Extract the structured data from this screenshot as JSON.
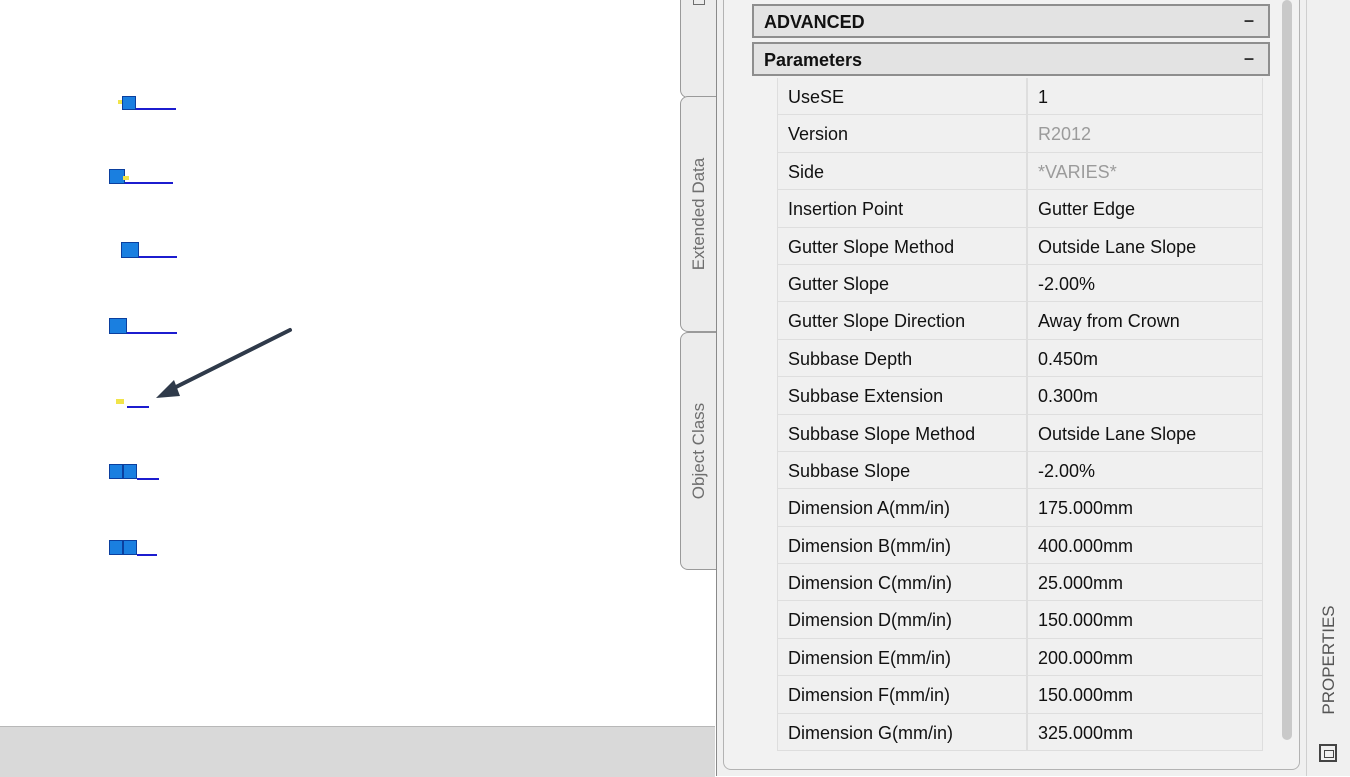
{
  "tabs": {
    "extended_data": "Extended Data",
    "object_class": "Object Class"
  },
  "sections": {
    "advanced": "ADVANCED",
    "parameters": "Parameters",
    "collapse_symbol": "–"
  },
  "properties": [
    {
      "name": "UseSE",
      "value": "1",
      "readonly": false
    },
    {
      "name": "Version",
      "value": "R2012",
      "readonly": true
    },
    {
      "name": "Side",
      "value": "*VARIES*",
      "readonly": true
    },
    {
      "name": "Insertion Point",
      "value": "Gutter Edge",
      "readonly": false
    },
    {
      "name": "Gutter Slope Method",
      "value": "Outside Lane Slope",
      "readonly": false
    },
    {
      "name": "Gutter Slope",
      "value": "-2.00%",
      "readonly": false
    },
    {
      "name": "Gutter Slope Direction",
      "value": "Away from Crown",
      "readonly": false
    },
    {
      "name": "Subbase Depth",
      "value": "0.450m",
      "readonly": false
    },
    {
      "name": "Subbase Extension",
      "value": "0.300m",
      "readonly": false
    },
    {
      "name": "Subbase Slope Method",
      "value": "Outside Lane Slope",
      "readonly": false
    },
    {
      "name": "Subbase Slope",
      "value": "-2.00%",
      "readonly": false
    },
    {
      "name": "Dimension A(mm/in)",
      "value": "175.000mm",
      "readonly": false
    },
    {
      "name": "Dimension B(mm/in)",
      "value": "400.000mm",
      "readonly": false
    },
    {
      "name": "Dimension C(mm/in)",
      "value": "25.000mm",
      "readonly": false
    },
    {
      "name": "Dimension D(mm/in)",
      "value": "150.000mm",
      "readonly": false
    },
    {
      "name": "Dimension E(mm/in)",
      "value": "200.000mm",
      "readonly": false
    },
    {
      "name": "Dimension F(mm/in)",
      "value": "150.000mm",
      "readonly": false
    },
    {
      "name": "Dimension G(mm/in)",
      "value": "325.000mm",
      "readonly": false
    }
  ],
  "dock": {
    "label": "PROPERTIES",
    "icon": "properties-palette-icon"
  },
  "colors": {
    "subassembly_fill": "#1a7fe0",
    "subassembly_line": "#1c1ccf",
    "grip": "#f1e44a",
    "readonly_text": "#9b9b9b",
    "arrow": "#2f3a4a"
  }
}
